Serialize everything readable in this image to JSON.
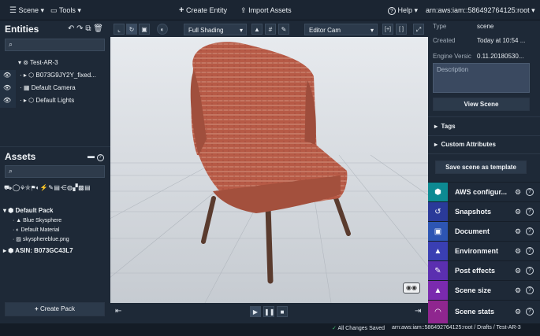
{
  "topbar": {
    "scene_menu": "Scene",
    "tools_menu": "Tools",
    "create_entity": "Create Entity",
    "import_assets": "Import Assets",
    "help_menu": "Help",
    "account": "arn:aws:iam::586492764125:root"
  },
  "entities": {
    "title": "Entities",
    "tree": [
      {
        "label": "Test-AR-3"
      },
      {
        "label": "B073G9JY2Y_fixed..."
      },
      {
        "label": "Default Camera"
      },
      {
        "label": "Default Lights"
      }
    ]
  },
  "assets": {
    "title": "Assets",
    "pack": "Default Pack",
    "items": [
      "Blue Skysphere",
      "Default Material",
      "skysphereblue.png"
    ],
    "asin": "ASIN: B073GC43L7",
    "create_pack": "Create Pack"
  },
  "toolbar": {
    "shading": "Full Shading",
    "camera": "Editor Cam"
  },
  "properties": {
    "type_label": "Type",
    "type_value": "scene",
    "created_label": "Created",
    "created_value": "Today at 10:54 ...",
    "engine_label": "Engine Versic",
    "engine_value": "0.11.20180530...",
    "description_placeholder": "Description",
    "view_scene": "View Scene",
    "tags": "Tags",
    "custom_attributes": "Custom Attributes",
    "save_template": "Save scene as template"
  },
  "panels": [
    {
      "label": "AWS configur...",
      "color": "#0d8a92",
      "icon": "cube-icon"
    },
    {
      "label": "Snapshots",
      "color": "#2a3a99",
      "icon": "history-icon"
    },
    {
      "label": "Document",
      "color": "#2d55b3",
      "icon": "frame-icon"
    },
    {
      "label": "Environment",
      "color": "#3a3fb3",
      "icon": "mountain-icon"
    },
    {
      "label": "Post effects",
      "color": "#5b2fb0",
      "icon": "wand-icon"
    },
    {
      "label": "Scene size",
      "color": "#7a2aae",
      "icon": "weight-icon"
    },
    {
      "label": "Scene stats",
      "color": "#8f268f",
      "icon": "gauge-icon"
    }
  ],
  "status": {
    "saved": "All Changes Saved",
    "path": "arn:aws:iam::586492764125:root  /  Drafts  /  Test-AR-3"
  },
  "colors": {
    "accent": "#0d8a92",
    "background": "#1b2532",
    "panel": "#1e2937"
  }
}
